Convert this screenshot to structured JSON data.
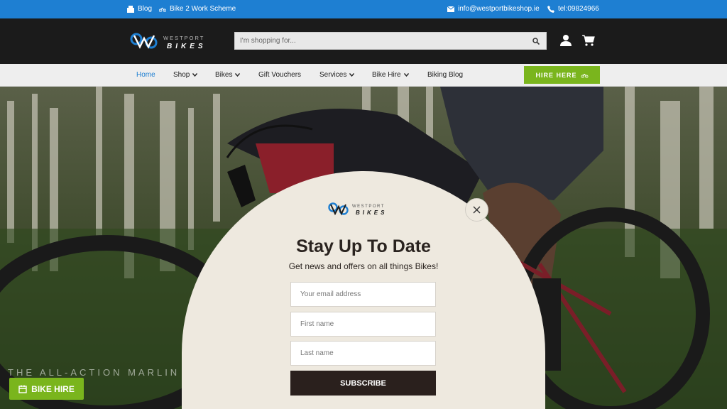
{
  "topbar": {
    "blog": "Blog",
    "bike2work": "Bike 2 Work Scheme",
    "email": "info@westportbikeshop.ie",
    "phone": "tel:09824966"
  },
  "brand": {
    "name_top": "WESTPORT",
    "name_bottom": "BIKES",
    "accent": "#1e7fd2",
    "green": "#7ab51d"
  },
  "search": {
    "placeholder": "I'm shopping for..."
  },
  "nav": {
    "items": [
      {
        "label": "Home",
        "active": true
      },
      {
        "label": "Shop",
        "dropdown": true
      },
      {
        "label": "Bikes",
        "dropdown": true
      },
      {
        "label": "Gift Vouchers"
      },
      {
        "label": "Services",
        "dropdown": true
      },
      {
        "label": "Bike Hire",
        "dropdown": true
      },
      {
        "label": "Biking Blog"
      }
    ],
    "hire_button": "HIRE HERE"
  },
  "hero": {
    "caption": "THE ALL-ACTION MARLIN",
    "bike_hire_button": "BIKE HIRE"
  },
  "popup": {
    "title": "Stay Up To Date",
    "subtitle": "Get news and offers on all things Bikes!",
    "email_placeholder": "Your email address",
    "first_name_placeholder": "First name",
    "last_name_placeholder": "Last name",
    "subscribe_label": "SUBSCRIBE"
  }
}
